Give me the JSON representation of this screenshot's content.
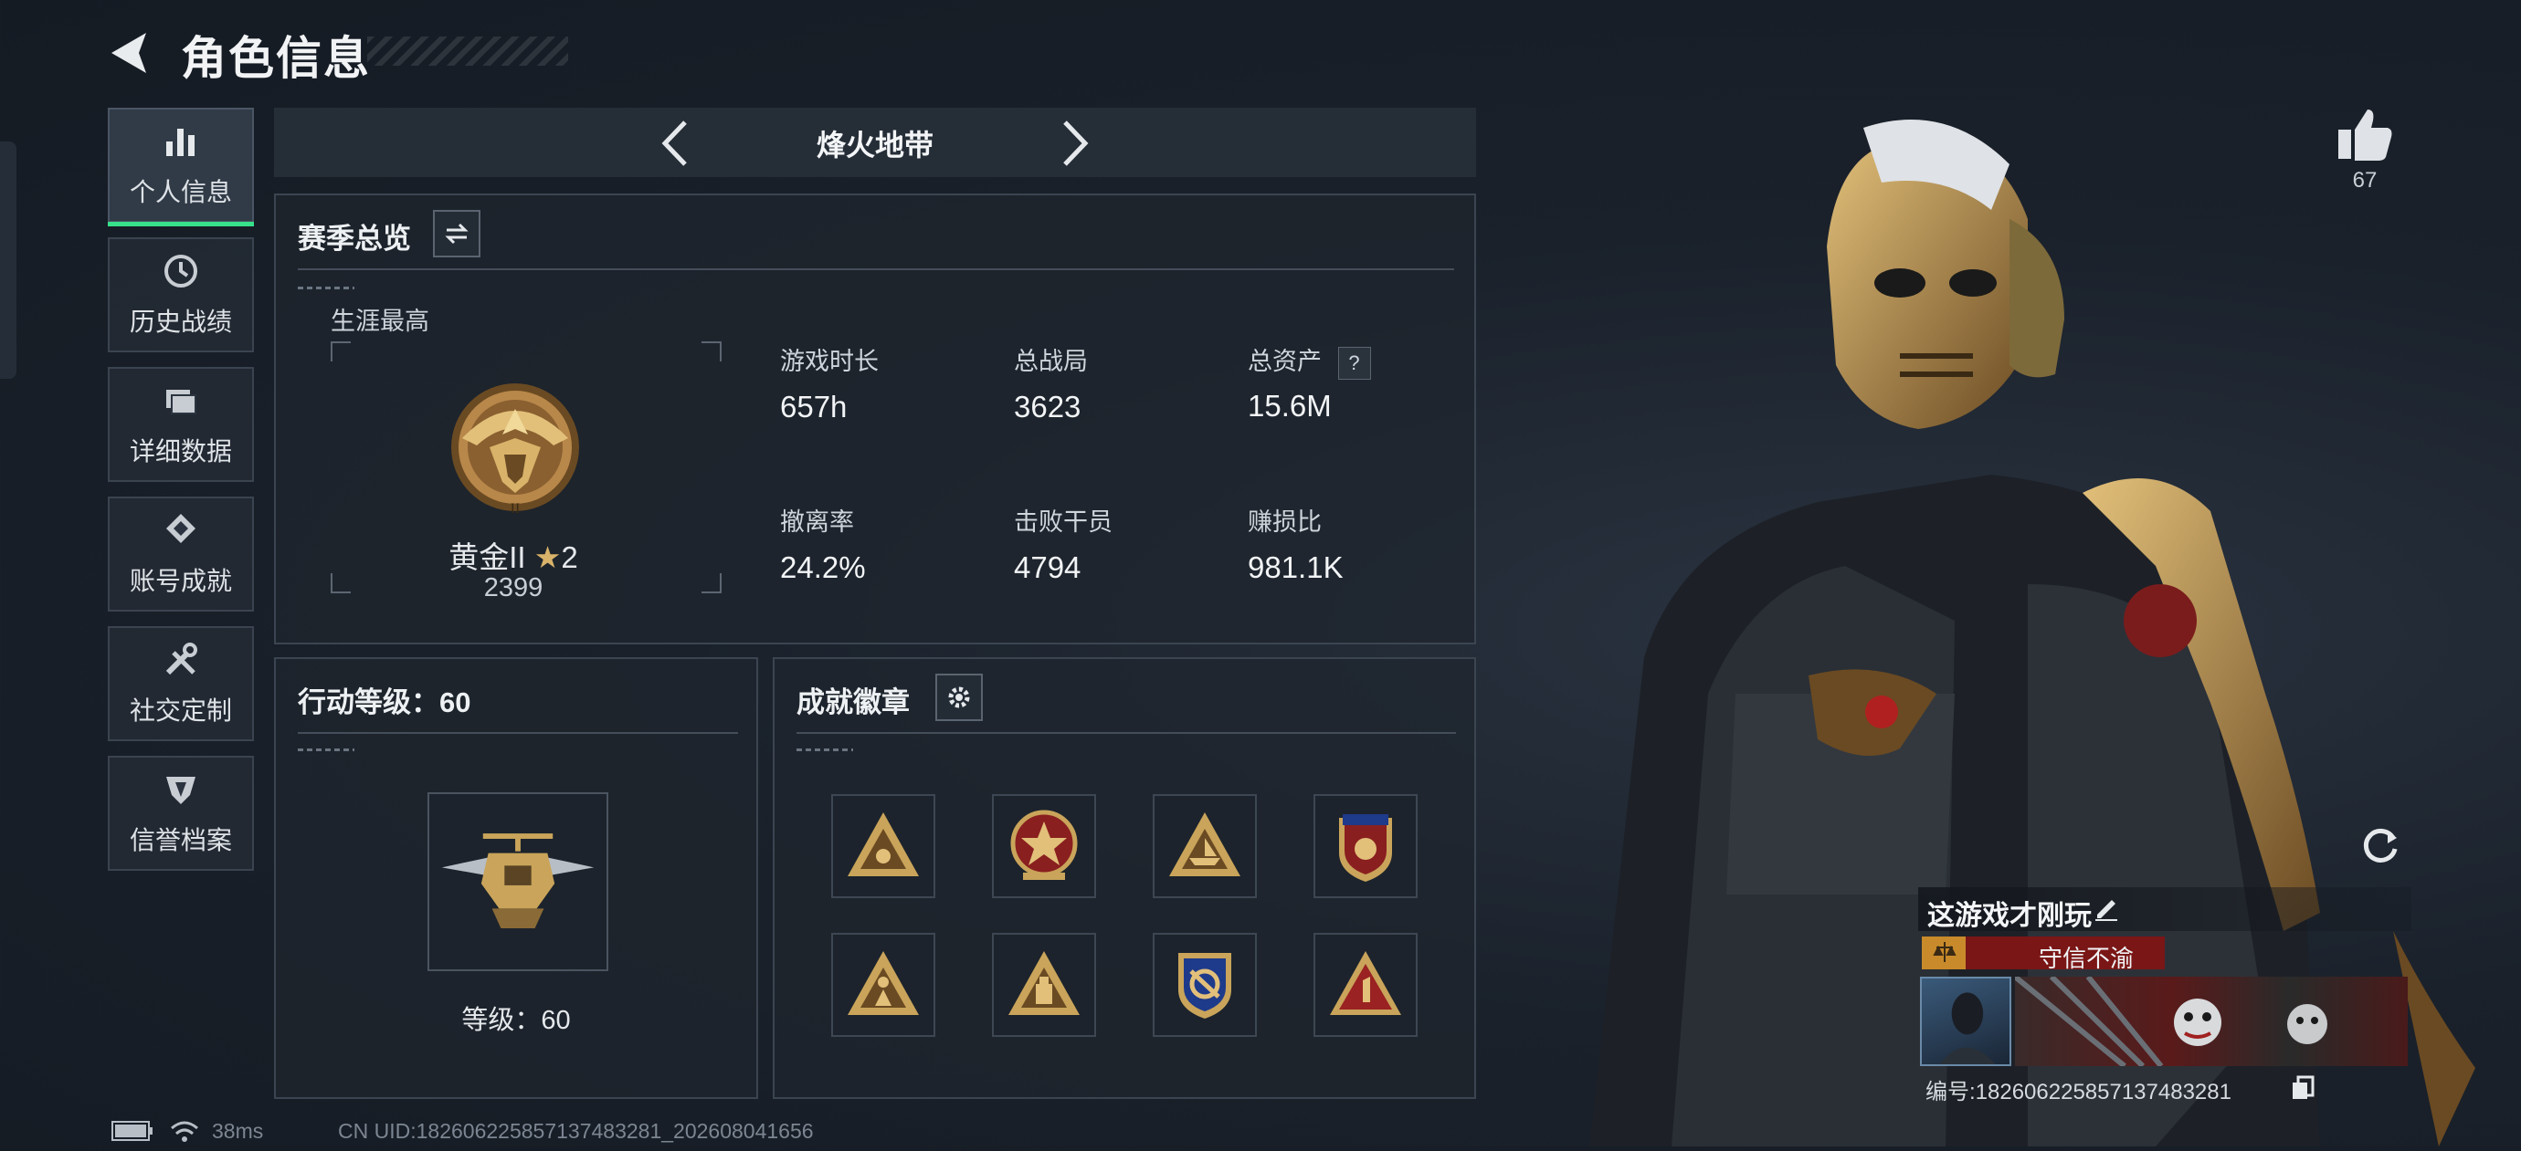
{
  "header": {
    "title": "角色信息"
  },
  "sidebar": {
    "items": [
      {
        "label": "个人信息",
        "icon": "bar-chart-icon",
        "active": true
      },
      {
        "label": "历史战绩",
        "icon": "history-clock-icon"
      },
      {
        "label": "详细数据",
        "icon": "folder-icon"
      },
      {
        "label": "账号成就",
        "icon": "achievement-icon"
      },
      {
        "label": "社交定制",
        "icon": "tools-icon"
      },
      {
        "label": "信誉档案",
        "icon": "reputation-icon"
      }
    ]
  },
  "mode": {
    "label": "烽火地带"
  },
  "season": {
    "title": "赛季总览",
    "career_best_label": "生涯最高",
    "rank_name": "黄金II",
    "rank_stars": "2",
    "rank_points": "2399",
    "stats": [
      {
        "label": "游戏时长",
        "value": "657h"
      },
      {
        "label": "总战局",
        "value": "3623"
      },
      {
        "label": "总资产",
        "value": "15.6M",
        "help": "?"
      },
      {
        "label": "撤离率",
        "value": "24.2%"
      },
      {
        "label": "击败干员",
        "value": "4794"
      },
      {
        "label": "赚损比",
        "value": "981.1K"
      }
    ]
  },
  "action_level": {
    "title": "行动等级：60",
    "level_text": "等级：60"
  },
  "achievements": {
    "title": "成就徽章",
    "badges": [
      "triangle-badge-icon",
      "star-shield-badge-icon",
      "boat-triangle-badge-icon",
      "flag-shield-badge-icon",
      "soldier-triangle-badge-icon",
      "gear-triangle-badge-icon",
      "anchor-shield-badge-icon",
      "number-one-triangle-badge-icon"
    ]
  },
  "likes": {
    "count": "67"
  },
  "profile": {
    "name": "这游戏才刚玩",
    "reputation_tag": "守信不渝",
    "id_label": "编号:1826062258571374832​81"
  },
  "status_bar": {
    "ping": "38ms",
    "uid": "CN UID:182606225857137483281_202608041656"
  },
  "colors": {
    "accent": "#37e08a",
    "gold": "#c9a45a",
    "tag_red": "#8a1a1a"
  }
}
